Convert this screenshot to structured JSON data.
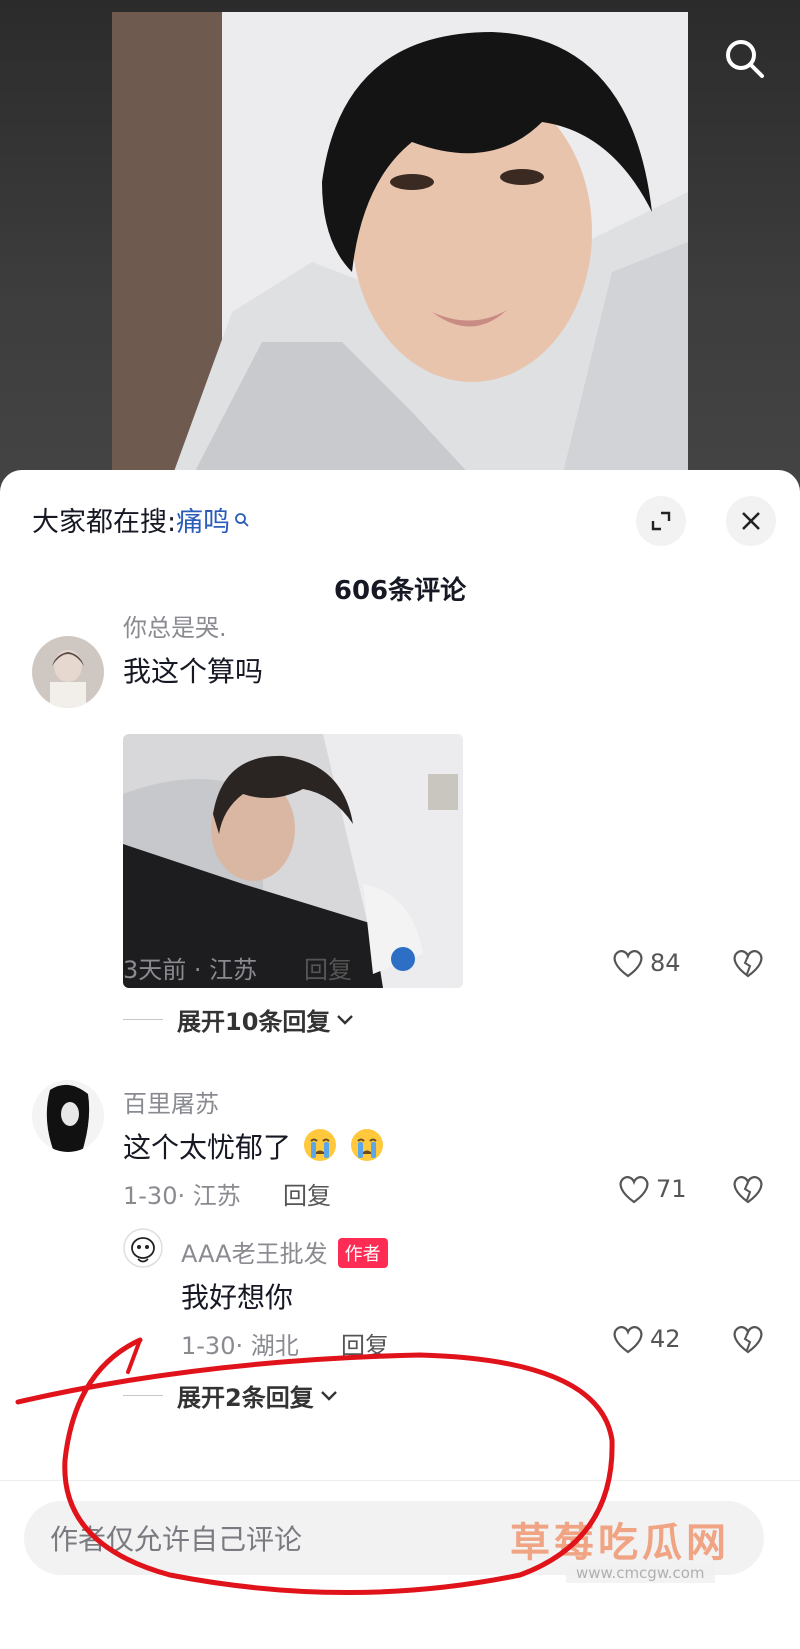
{
  "top": {
    "search_icon": "search-icon"
  },
  "sheet": {
    "hot_search_prefix": "大家都在搜:",
    "hot_search_keyword": "痛鸣",
    "comment_count_label": "606条评论",
    "input_placeholder": "作者仅允许自己评论"
  },
  "comments": [
    {
      "username": "你总是哭.",
      "text": "我这个算吗",
      "time_location": "3天前 · 江苏",
      "reply_label": "回复",
      "likes": "84",
      "expand_label": "展开10条回复"
    },
    {
      "username": "百里屠苏",
      "text": "这个太忧郁了",
      "time_location": "1-30· 江苏",
      "reply_label": "回复",
      "likes": "71",
      "replies": [
        {
          "username": "AAA老王批发",
          "badge": "作者",
          "text": "我好想你",
          "time_location": "1-30· 湖北",
          "reply_label": "回复",
          "likes": "42"
        }
      ],
      "expand_label": "展开2条回复"
    }
  ],
  "watermark": {
    "text": "草莓吃瓜网",
    "url": "www.cmcgw.com"
  },
  "colors": {
    "accent_link": "#2b5db8",
    "author_badge": "#fe2c55",
    "annotation_red": "#e0131b"
  }
}
